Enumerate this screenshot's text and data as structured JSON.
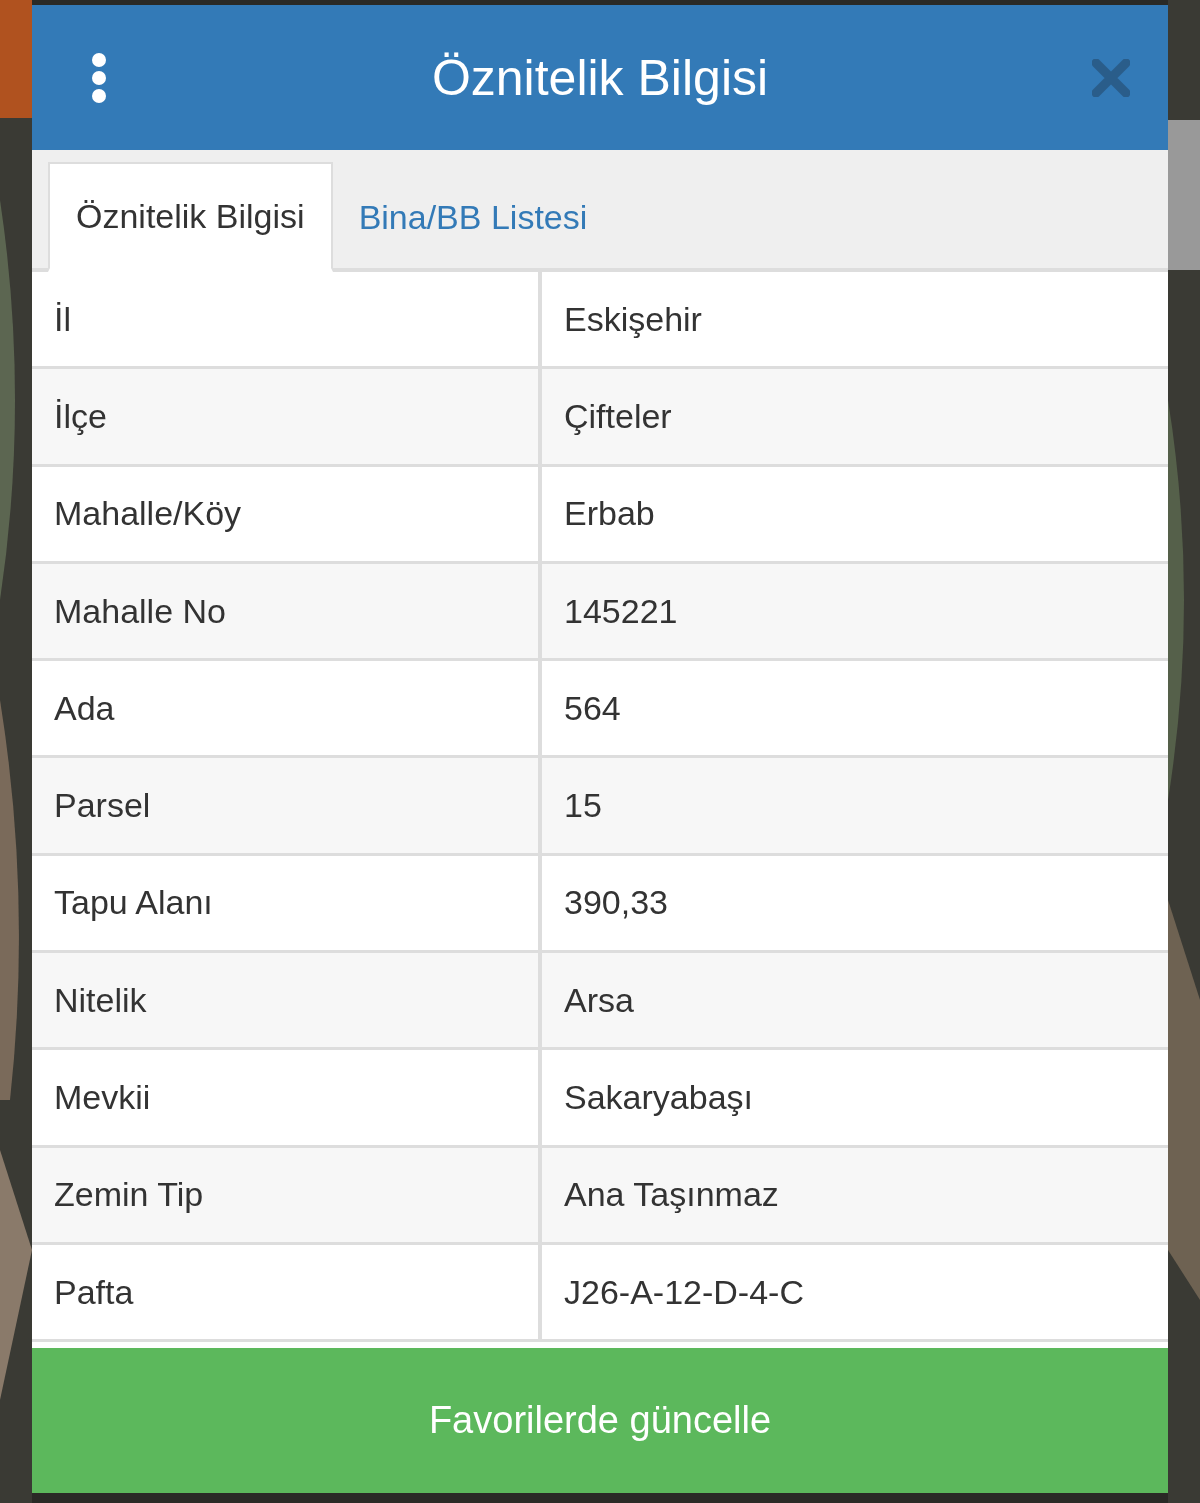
{
  "dialog": {
    "title": "Öznitelik Bilgisi"
  },
  "tabs": [
    {
      "label": "Öznitelik Bilgisi",
      "selected": true
    },
    {
      "label": "Bina/BB Listesi",
      "selected": false
    }
  ],
  "rows": [
    {
      "label": "İl",
      "value": "Eskişehir"
    },
    {
      "label": "İlçe",
      "value": "Çifteler"
    },
    {
      "label": "Mahalle/Köy",
      "value": "Erbab"
    },
    {
      "label": "Mahalle No",
      "value": "145221"
    },
    {
      "label": "Ada",
      "value": "564"
    },
    {
      "label": "Parsel",
      "value": "15"
    },
    {
      "label": "Tapu Alanı",
      "value": "390,33"
    },
    {
      "label": "Nitelik",
      "value": "Arsa"
    },
    {
      "label": "Mevkii",
      "value": "Sakaryabaşı"
    },
    {
      "label": "Zemin Tip",
      "value": "Ana Taşınmaz"
    },
    {
      "label": "Pafta",
      "value": "J26-A-12-D-4-C"
    }
  ],
  "button": {
    "label": "Favorilerde güncelle"
  }
}
